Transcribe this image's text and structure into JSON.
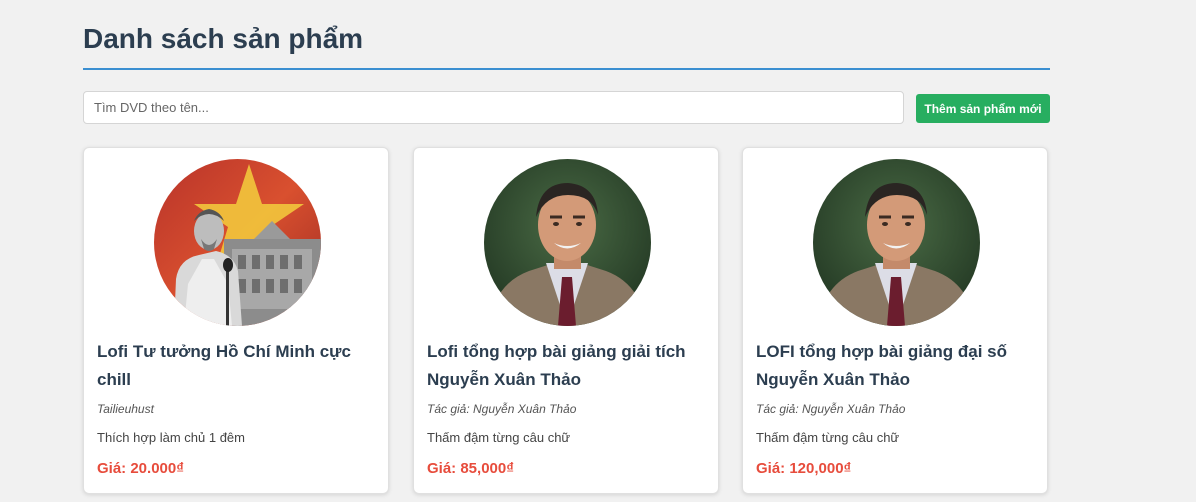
{
  "page": {
    "title": "Danh sách sản phẩm"
  },
  "toolbar": {
    "search_placeholder": "Tìm DVD theo tên...",
    "add_label": "Thêm sản phẩm mới"
  },
  "colors": {
    "accent": "#3b8fd1",
    "add_button": "#27ae60",
    "price": "#e74c3c",
    "title": "#2c3e50"
  },
  "products": [
    {
      "title": "Lofi Tư tưởng Hồ Chí Minh cực chill",
      "author": "Tailieuhust",
      "description": "Thích hợp làm chủ 1 đêm",
      "price": "Giá: 20.000₫",
      "image": "historical-portrait-flag-image"
    },
    {
      "title": "Lofi tổng hợp bài giảng giải tích Nguyễn Xuân Thảo",
      "author": "Tác giả: Nguyễn Xuân Thảo",
      "description": "Thấm đậm từng câu chữ",
      "price": "Giá: 85,000₫",
      "image": "lecturer-portrait-image"
    },
    {
      "title": "LOFI tổng hợp bài giảng đại số Nguyễn Xuân Thảo",
      "author": "Tác giả: Nguyễn Xuân Thảo",
      "description": "Thấm đậm từng câu chữ",
      "price": "Giá: 120,000₫",
      "image": "lecturer-portrait-image"
    }
  ]
}
